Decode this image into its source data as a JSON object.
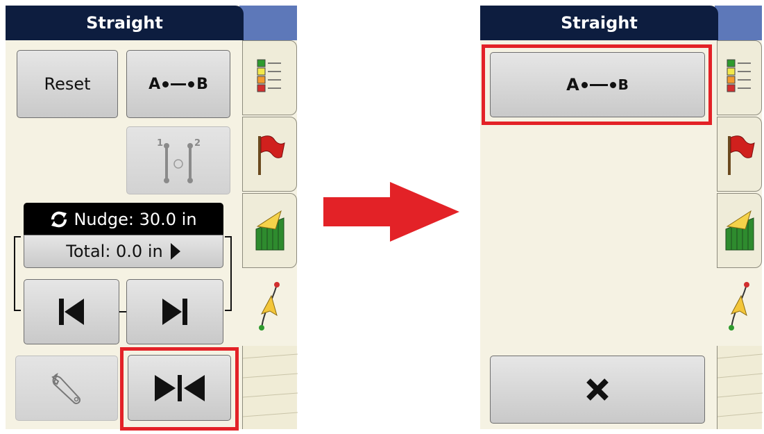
{
  "left_panel": {
    "title": "Straight",
    "reset_label": "Reset",
    "ab_label": {
      "a": "A",
      "b": "B"
    },
    "two_point_label": {
      "p1": "1",
      "p2": "2"
    },
    "nudge_label": "Nudge: 30.0 in",
    "total_label": "Total: 0.0 in"
  },
  "right_panel": {
    "title": "Straight",
    "ab_label": {
      "a": "A",
      "b": "B"
    }
  },
  "icons": {
    "nudge": "refresh-icon",
    "total": "play-right-icon",
    "shift_left": "shift-left-icon",
    "shift_right": "shift-right-icon",
    "settings": "wrench-icon",
    "recenter": "recenter-icon",
    "cancel": "close-icon",
    "transition": "arrow-right-icon"
  },
  "colors": {
    "title_bg": "#0d1d3f",
    "panel_bg": "#f5f2e3",
    "highlight": "#e32227",
    "arrow": "#e32227"
  }
}
